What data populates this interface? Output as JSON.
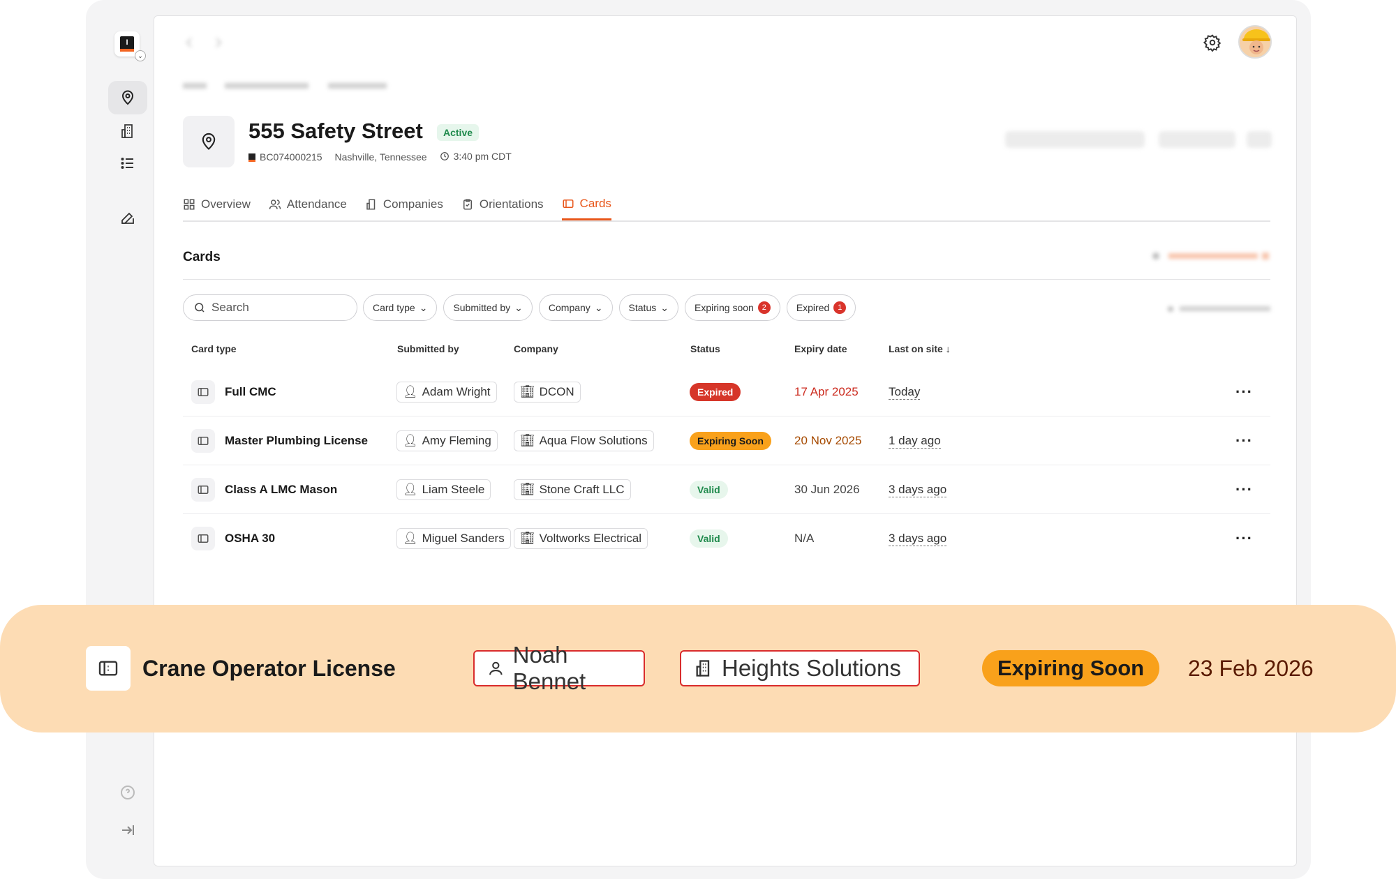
{
  "rail": {
    "logo_letter": "I",
    "items": [
      "location-pin",
      "buildings",
      "list",
      "edit"
    ],
    "bottom": [
      "help",
      "collapse"
    ]
  },
  "site": {
    "title": "555 Safety Street",
    "status": "Active",
    "code": "BC074000215",
    "location": "Nashville, Tennessee",
    "time": "3:40 pm CDT"
  },
  "tabs": [
    {
      "label": "Overview",
      "icon": "grid-icon"
    },
    {
      "label": "Attendance",
      "icon": "people-icon"
    },
    {
      "label": "Companies",
      "icon": "building-icon"
    },
    {
      "label": "Orientations",
      "icon": "clipboard-icon"
    },
    {
      "label": "Cards",
      "icon": "card-icon",
      "active": true
    }
  ],
  "section_title": "Cards",
  "search_placeholder": "Search",
  "filters": [
    {
      "label": "Card type"
    },
    {
      "label": "Submitted by"
    },
    {
      "label": "Company"
    },
    {
      "label": "Status"
    },
    {
      "label": "Expiring soon",
      "count": "2"
    },
    {
      "label": "Expired",
      "count": "1"
    }
  ],
  "columns": [
    "Card type",
    "Submitted by",
    "Company",
    "Status",
    "Expiry date",
    "Last on site"
  ],
  "rows": [
    {
      "card_type": "Full CMC",
      "submitted_by": "Adam Wright",
      "company": "DCON",
      "status": "Expired",
      "expiry": "17 Apr 2025",
      "last": "Today"
    },
    {
      "card_type": "Master Plumbing License",
      "submitted_by": "Amy Fleming",
      "company": "Aqua Flow Solutions",
      "status": "Expiring Soon",
      "expiry": "20 Nov 2025",
      "last": "1 day ago"
    },
    {
      "card_type": "Class A LMC Mason",
      "submitted_by": "Liam Steele",
      "company": "Stone Craft LLC",
      "status": "Valid",
      "expiry": "30 Jun 2026",
      "last": "3 days ago"
    },
    {
      "card_type": "OSHA 30",
      "submitted_by": "Miguel Sanders",
      "company": "Voltworks Electrical",
      "status": "Valid",
      "expiry": "N/A",
      "last": "3 days ago"
    }
  ],
  "highlight": {
    "card_type": "Crane Operator License",
    "submitted_by": "Noah Bennet",
    "company": "Heights Solutions",
    "status": "Expiring Soon",
    "expiry": "23 Feb 2026"
  },
  "colors": {
    "accent": "#e8561a",
    "expired": "#d63629",
    "expiring": "#f9a11b",
    "valid": "#1f8a4c",
    "highlight_band": "#fddcb4"
  }
}
